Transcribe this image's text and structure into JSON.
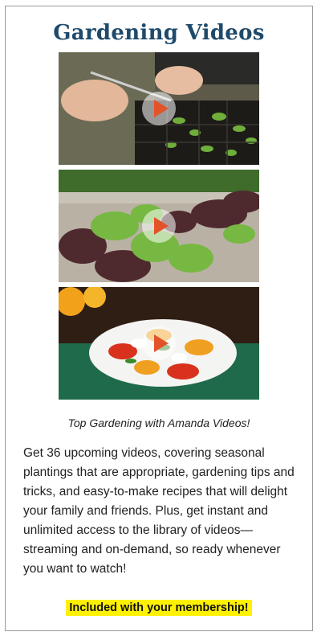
{
  "header": {
    "title": "Gardening Videos"
  },
  "videos": [
    {
      "subject": "seedlings-tray",
      "play_icon": "play-icon"
    },
    {
      "subject": "lettuce-garden-bed",
      "play_icon": "play-icon"
    },
    {
      "subject": "caprese-salad-plate",
      "play_icon": "play-icon"
    }
  ],
  "caption": "Top Gardening with Amanda Videos!",
  "description": "Get 36 upcoming videos, covering seasonal plantings that are appropriate, gardening tips and tricks, and easy-to-make recipes that will delight your family and friends. Plus, get instant and unlimited access to the library of videos—streaming and on-demand, so ready whenever you want to watch!",
  "cta": "Included with your membership!",
  "colors": {
    "title": "#1f4a6b",
    "play": "#e2532a",
    "highlight": "#fff200"
  }
}
